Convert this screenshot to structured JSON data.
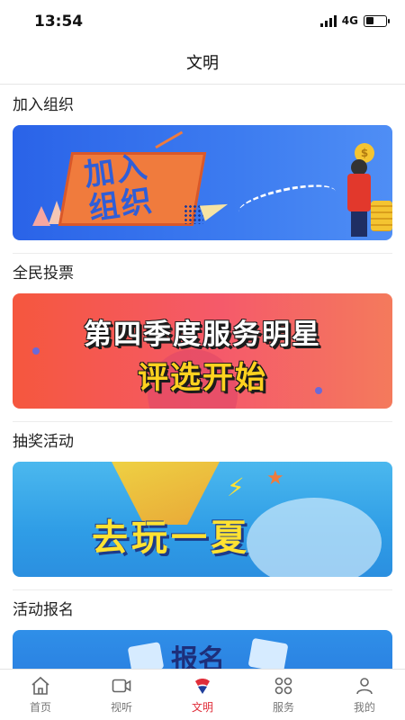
{
  "status": {
    "time": "13:54",
    "network": "4G"
  },
  "header": {
    "title": "文明"
  },
  "sections": [
    {
      "title": "加入组织",
      "banner_text": "加入\n组织"
    },
    {
      "title": "全民投票",
      "banner_line1": "第四季度服务明星",
      "banner_line2": "评选开始"
    },
    {
      "title": "抽奖活动",
      "banner_text": "去玩一夏"
    },
    {
      "title": "活动报名",
      "banner_text": "报名"
    }
  ],
  "tabbar": {
    "items": [
      {
        "label": "首页",
        "icon": "home-icon"
      },
      {
        "label": "视听",
        "icon": "video-icon"
      },
      {
        "label": "文明",
        "icon": "civilization-icon"
      },
      {
        "label": "服务",
        "icon": "services-icon"
      },
      {
        "label": "我的",
        "icon": "user-icon"
      }
    ],
    "active_index": 2
  },
  "colors": {
    "accent": "#e02e3a",
    "banner_blue": "#3d7cf0",
    "banner_red": "#f5573e"
  }
}
